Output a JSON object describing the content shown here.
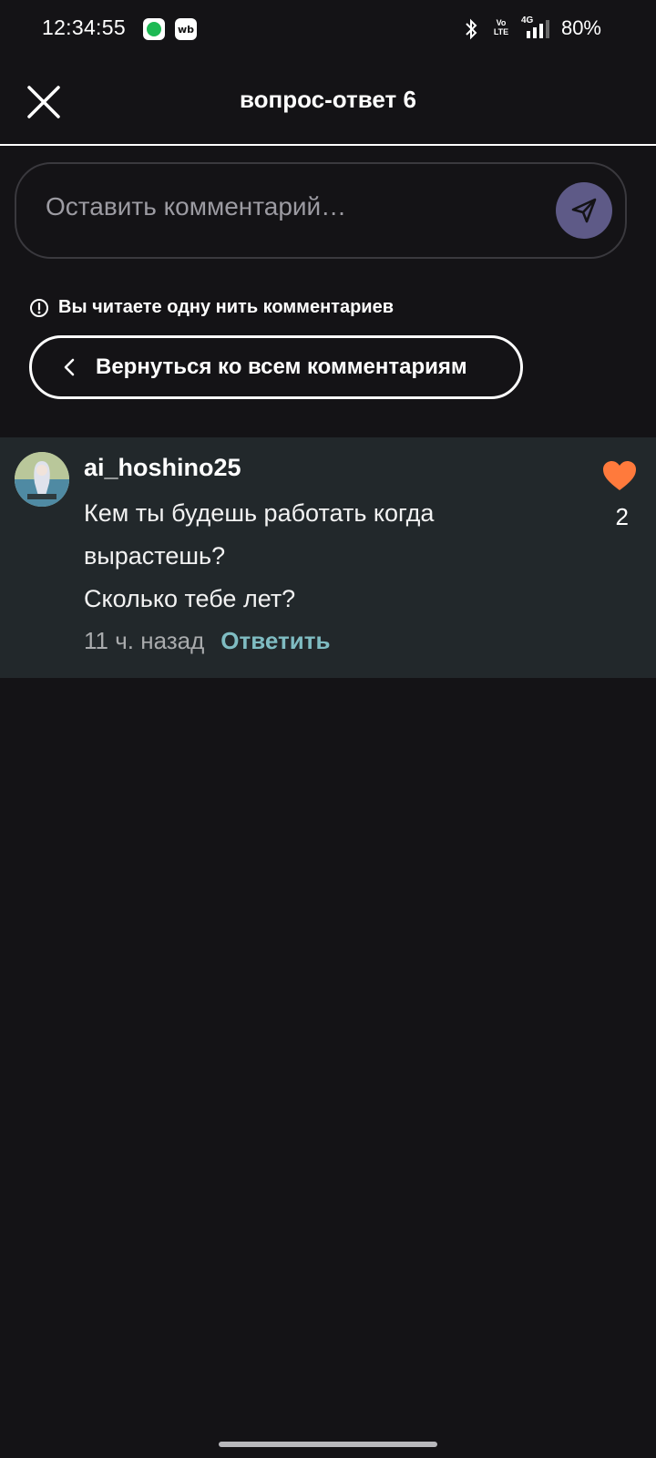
{
  "status_bar": {
    "time": "12:34:55",
    "notif_icons": [
      "spotify-icon",
      "wb-icon"
    ],
    "wb_label": "wb",
    "battery": "80%",
    "network_label": "4G",
    "volte_label": "Vo LTE"
  },
  "header": {
    "title": "вопрос-ответ 6",
    "close_icon": "close-icon"
  },
  "comment_input": {
    "placeholder": "Оставить комментарий…",
    "value": "",
    "send_icon": "send-icon"
  },
  "thread": {
    "notice": "Вы читаете одну нить комментариев",
    "back_button_label": "Вернуться ко всем комментариям"
  },
  "comment": {
    "username": "ai_hoshino25",
    "lines": [
      "Кем ты будешь работать когда вырастешь?",
      "Сколько тебе лет?"
    ],
    "time": "11 ч. назад",
    "reply_label": "Ответить",
    "like_count": "2",
    "colors": {
      "like": "#ff7a3c",
      "reply": "#7fbcc2",
      "card_bg": "#22282b"
    }
  }
}
